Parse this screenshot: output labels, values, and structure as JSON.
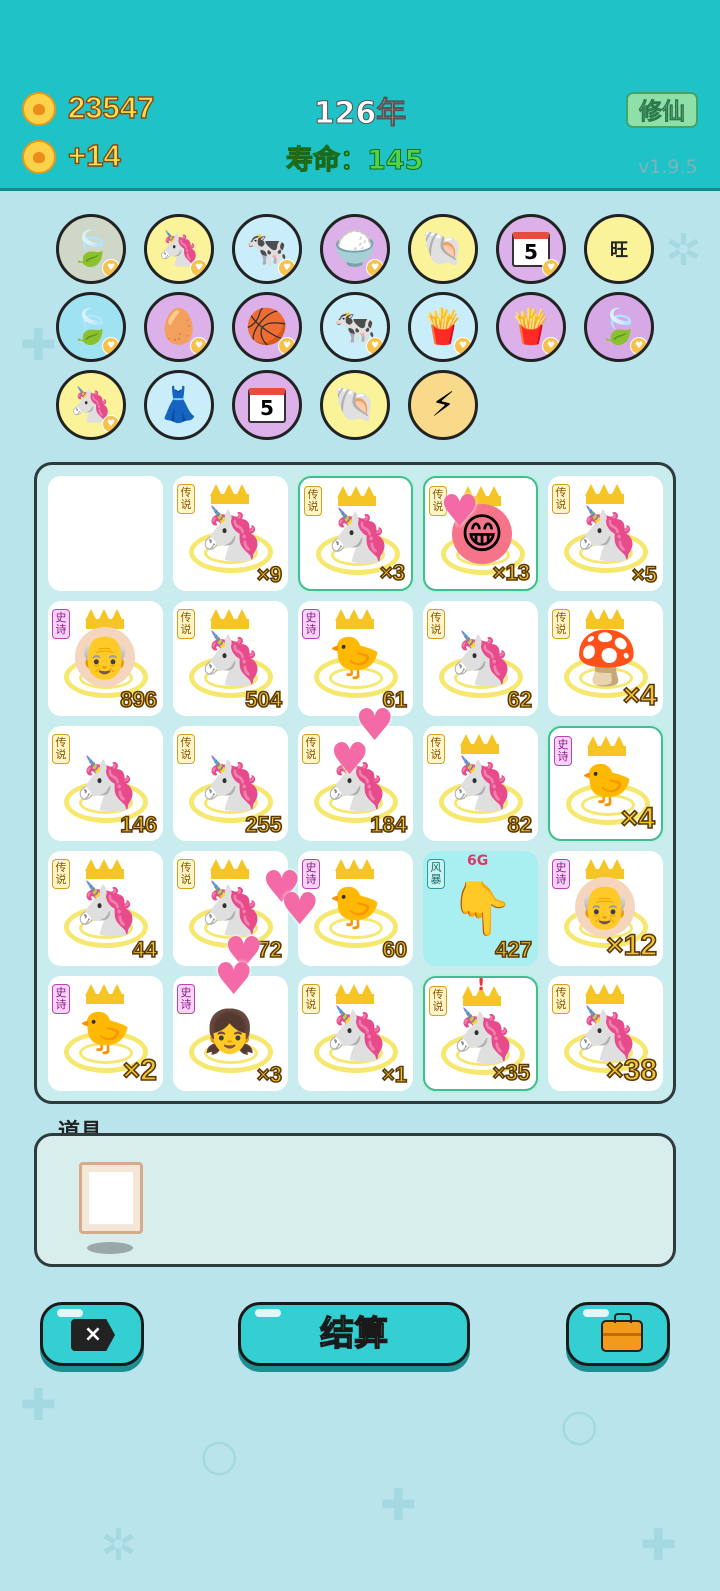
{
  "header": {
    "coins": "23547",
    "coins_per_turn": "+14",
    "year": "126年",
    "lifespan_label": "寿命：",
    "lifespan_value": "145",
    "cultivate_button": "修仙",
    "version": "v1.9.5"
  },
  "pool": {
    "icons": [
      "leaf-icon",
      "unicorn-icon",
      "cattle-pair-icon",
      "rice-bowl-icon",
      "shell-icon",
      "calendar-icon",
      "wang-tiles-icon",
      "leaf-icon",
      "egg-icon",
      "basketballs-icon",
      "cattle-pair-icon",
      "fries-icon",
      "fries-icon",
      "leaf-icon",
      "unicorn-icon",
      "skirt-icon",
      "calendar-icon",
      "shell-icon",
      "lightning-icon"
    ],
    "calendar_number": "5",
    "wang_char": "旺"
  },
  "tags": {
    "legend": "传说",
    "epic": "史诗",
    "wind": "风暴"
  },
  "board": {
    "cells": [
      {
        "kind": "empty",
        "tag": "",
        "count": ""
      },
      {
        "kind": "unicorn",
        "tag": "legend",
        "crown": true,
        "count": "×9",
        "size": "s"
      },
      {
        "kind": "unicorn",
        "tag": "legend",
        "crown": true,
        "count": "×3",
        "size": "s",
        "selected": true
      },
      {
        "kind": "face",
        "tag": "legend",
        "crown": true,
        "count": "×13",
        "size": "s",
        "selected": true,
        "hearted": true
      },
      {
        "kind": "unicorn",
        "tag": "legend",
        "crown": true,
        "count": "×5",
        "size": "s"
      },
      {
        "kind": "oldman",
        "tag": "epic",
        "crown": true,
        "count": "896",
        "size": "s"
      },
      {
        "kind": "unicorn",
        "tag": "legend",
        "crown": true,
        "count": "504",
        "size": "s"
      },
      {
        "kind": "chick",
        "tag": "epic",
        "crown": true,
        "count": "61",
        "size": "s"
      },
      {
        "kind": "unicorn",
        "tag": "legend",
        "crown": false,
        "count": "62",
        "size": "s"
      },
      {
        "kind": "mushroom",
        "tag": "legend",
        "crown": true,
        "count": "×4",
        "size": "l"
      },
      {
        "kind": "unicorn",
        "tag": "legend",
        "crown": false,
        "count": "146",
        "size": "s"
      },
      {
        "kind": "unicorn",
        "tag": "legend",
        "crown": false,
        "count": "255",
        "size": "s"
      },
      {
        "kind": "unicorn",
        "tag": "legend",
        "crown": false,
        "count": "184",
        "size": "s"
      },
      {
        "kind": "unicorn",
        "tag": "legend",
        "crown": true,
        "count": "82",
        "size": "s"
      },
      {
        "kind": "chick",
        "tag": "epic",
        "crown": true,
        "count": "×4",
        "size": "l",
        "selected": true
      },
      {
        "kind": "unicorn",
        "tag": "legend",
        "crown": true,
        "count": "44",
        "size": "s"
      },
      {
        "kind": "unicorn",
        "tag": "legend",
        "crown": true,
        "count": "72",
        "size": "s"
      },
      {
        "kind": "chick",
        "tag": "epic",
        "crown": true,
        "count": "60",
        "size": "s"
      },
      {
        "kind": "hand",
        "tag": "wind",
        "crown": false,
        "count": "427",
        "size": "s",
        "blue": true,
        "badge": "6G"
      },
      {
        "kind": "oldman",
        "tag": "epic",
        "crown": true,
        "count": "×12",
        "size": "l"
      },
      {
        "kind": "chick",
        "tag": "epic",
        "crown": true,
        "count": "×2",
        "size": "l"
      },
      {
        "kind": "girl",
        "tag": "epic",
        "crown": false,
        "count": "×3",
        "size": "s"
      },
      {
        "kind": "unicorn",
        "tag": "legend",
        "crown": true,
        "count": "×1",
        "size": "s"
      },
      {
        "kind": "unicorn",
        "tag": "legend",
        "crown": true,
        "count": "×35",
        "size": "s",
        "selected": true,
        "alert": "!"
      },
      {
        "kind": "unicorn",
        "tag": "legend",
        "crown": true,
        "count": "×38",
        "size": "l"
      }
    ]
  },
  "items": {
    "label": "道具",
    "slots": [
      "picture-frame-icon"
    ]
  },
  "footer": {
    "settle_label": "结算",
    "delete_icon": "×"
  }
}
